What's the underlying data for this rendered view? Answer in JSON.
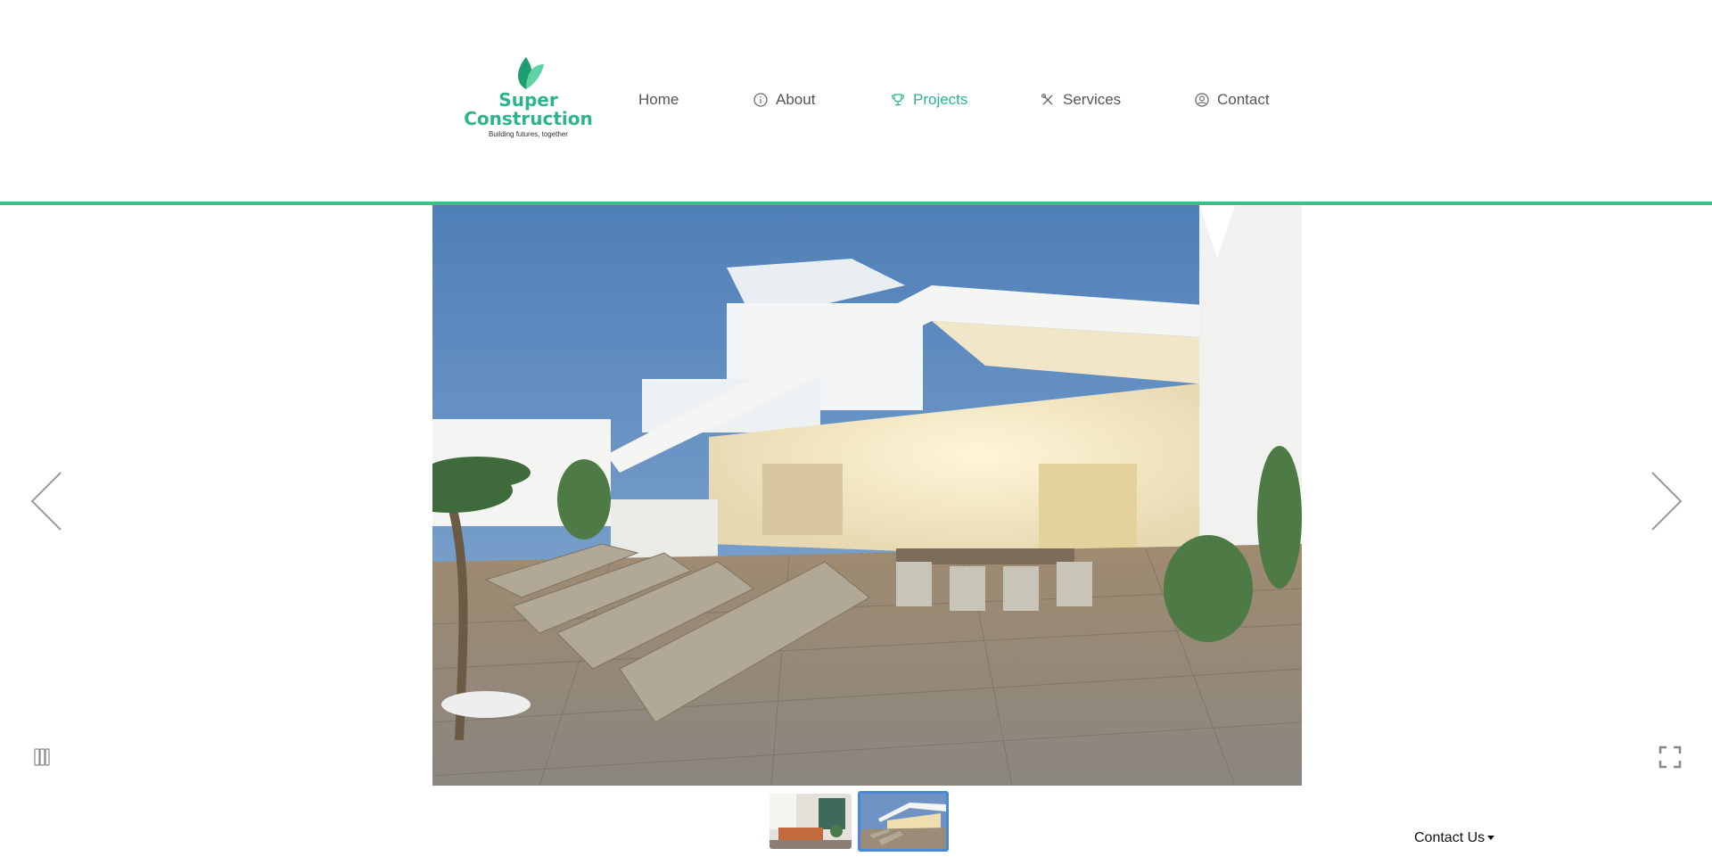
{
  "brand": {
    "name_line1": "Super",
    "name_line2": "Construction",
    "tagline": "Building futures, together",
    "color": "#2bb58a"
  },
  "nav": {
    "items": [
      {
        "label": "Home",
        "icon": "none"
      },
      {
        "label": "About",
        "icon": "info-circle-icon"
      },
      {
        "label": "Projects",
        "icon": "trophy-icon",
        "active": true
      },
      {
        "label": "Services",
        "icon": "tools-icon"
      },
      {
        "label": "Contact",
        "icon": "user-circle-icon"
      }
    ],
    "accent_color": "#3bbf87"
  },
  "gallery": {
    "prev_icon": "chevron-left-icon",
    "next_icon": "chevron-right-icon",
    "play_pause_icon": "pause-icon",
    "fullscreen_icon": "fullscreen-icon",
    "current_slide": 2,
    "total_slides": 2
  },
  "footer": {
    "contact_us": "Contact Us"
  }
}
